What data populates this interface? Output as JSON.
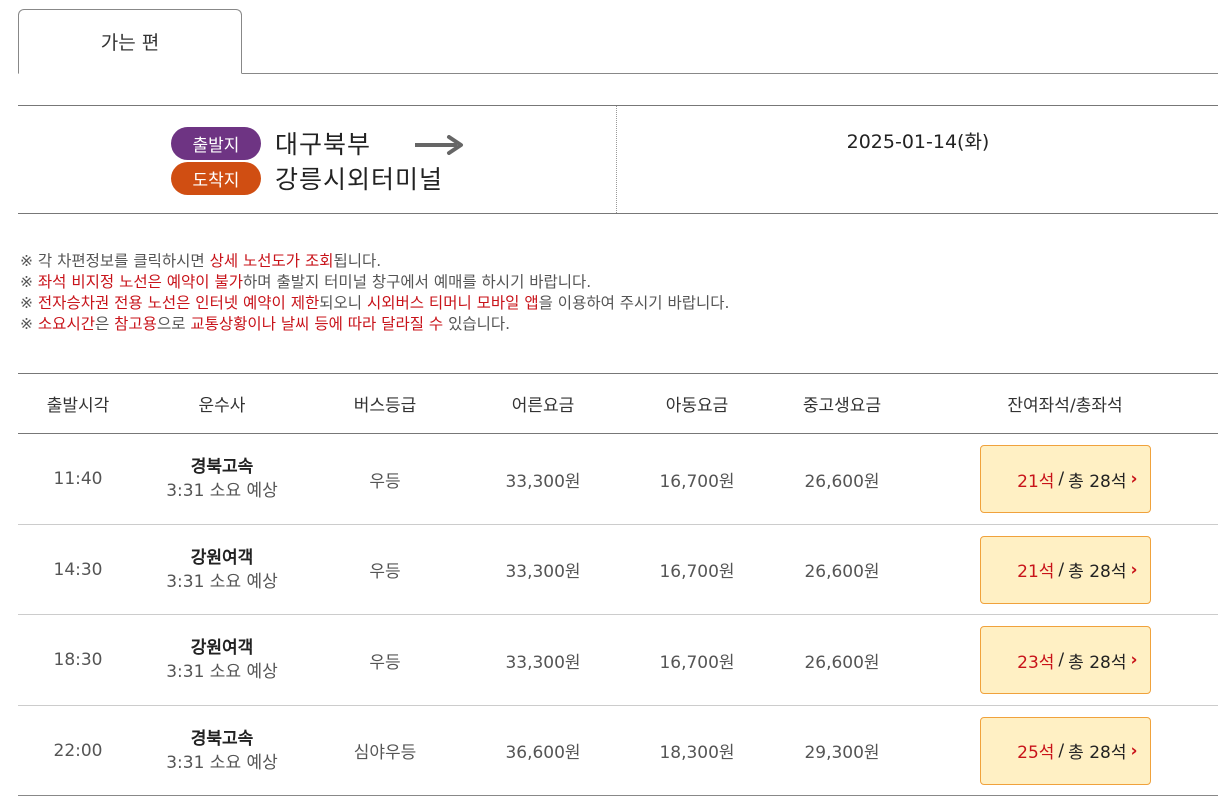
{
  "tab": {
    "label": "가는 편"
  },
  "route": {
    "departure_label": "출발지",
    "departure": "대구북부",
    "arrival_label": "도착지",
    "arrival": "강릉시외터미널",
    "date": "2025-01-14(화)",
    "colors": {
      "departure": "#6e3483",
      "arrival": "#d04e12"
    }
  },
  "notices": [
    [
      {
        "t": "※ 각 차편정보를 클릭하시면 "
      },
      {
        "t": "상세 노선도가 조회",
        "hl": true
      },
      {
        "t": "됩니다."
      }
    ],
    [
      {
        "t": "※ "
      },
      {
        "t": "좌석 비지정 노선은 예약이 불가",
        "hl": true
      },
      {
        "t": "하며 출발지 터미널 창구에서 예매를 하시기 바랍니다."
      }
    ],
    [
      {
        "t": "※ "
      },
      {
        "t": "전자승차권 전용 노선은 인터넷 예약이 제한",
        "hl": true
      },
      {
        "t": "되오니 "
      },
      {
        "t": "시외버스 티머니 모바일 앱",
        "hl": true
      },
      {
        "t": "을 이용하여 주시기 바랍니다."
      }
    ],
    [
      {
        "t": "※ "
      },
      {
        "t": "소요시간",
        "hl": true
      },
      {
        "t": "은 "
      },
      {
        "t": "참고용",
        "hl": true
      },
      {
        "t": "으로 "
      },
      {
        "t": "교통상황이나 날씨 등에 따라 달라질 수",
        "hl": true
      },
      {
        "t": " 있습니다."
      }
    ]
  ],
  "table": {
    "headers": {
      "time": "출발시각",
      "company": "운수사",
      "grade": "버스등급",
      "adult": "어른요금",
      "child": "아동요금",
      "teen": "중고생요금",
      "seats": "잔여좌석/총좌석"
    },
    "rows": [
      {
        "time": "11:40",
        "company": "경북고속",
        "duration": "3:31 소요 예상",
        "grade": "우등",
        "adult": "33,300원",
        "child": "16,700원",
        "teen": "26,600원",
        "remain": "21석",
        "sep": "/",
        "total": "총 28석"
      },
      {
        "time": "14:30",
        "company": "강원여객",
        "duration": "3:31 소요 예상",
        "grade": "우등",
        "adult": "33,300원",
        "child": "16,700원",
        "teen": "26,600원",
        "remain": "21석",
        "sep": "/",
        "total": "총 28석"
      },
      {
        "time": "18:30",
        "company": "강원여객",
        "duration": "3:31 소요 예상",
        "grade": "우등",
        "adult": "33,300원",
        "child": "16,700원",
        "teen": "26,600원",
        "remain": "23석",
        "sep": "/",
        "total": "총 28석"
      },
      {
        "time": "22:00",
        "company": "경북고속",
        "duration": "3:31 소요 예상",
        "grade": "심야우등",
        "adult": "36,600원",
        "child": "18,300원",
        "teen": "29,300원",
        "remain": "25석",
        "sep": "/",
        "total": "총 28석"
      }
    ],
    "chevron_icon": "chevron-right-icon",
    "highlight_color": "#c8131a"
  }
}
